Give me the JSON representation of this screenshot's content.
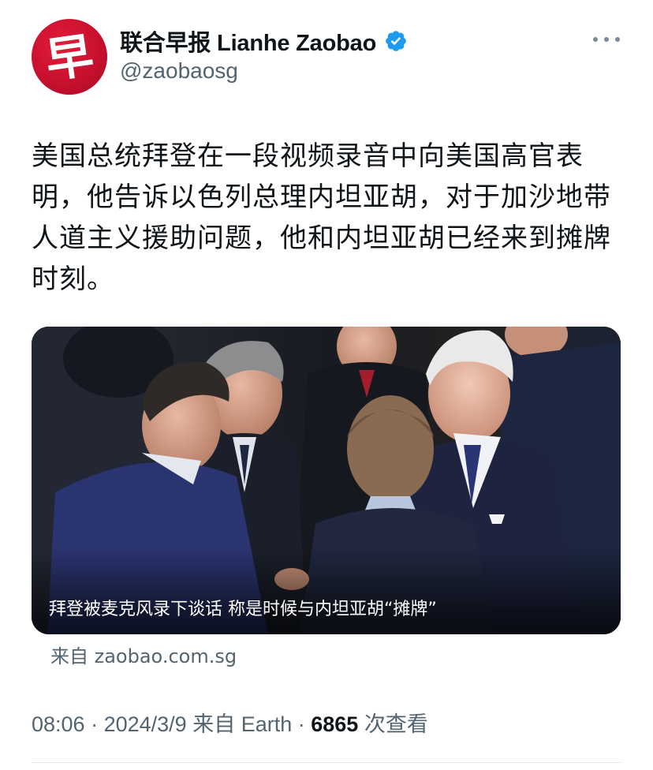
{
  "account": {
    "display_name": "联合早报 Lianhe Zaobao",
    "handle": "@zaobaosg",
    "avatar_char": "早",
    "avatar_color": "#c8102e",
    "verified": true,
    "verified_icon": "verified-badge-icon",
    "verified_color": "#1d9bf0"
  },
  "more_icon": "more-horizontal-icon",
  "tweet": {
    "text": "美国总统拜登在一段视频录音中向美国高官表明，他告诉以色列总理内坦亚胡，对于加沙地带人道主义援助问题，他和内坦亚胡已经来到摊牌时刻。"
  },
  "media": {
    "caption": "拜登被麦克风录下谈话 称是时候与内坦亚胡“摊牌”"
  },
  "source": "来自 zaobao.com.sg",
  "meta": {
    "time": "08:06",
    "separator": " · ",
    "date": "2024/3/9",
    "client": "来自 Earth",
    "views_count": "6865",
    "views_label": "次查看"
  }
}
